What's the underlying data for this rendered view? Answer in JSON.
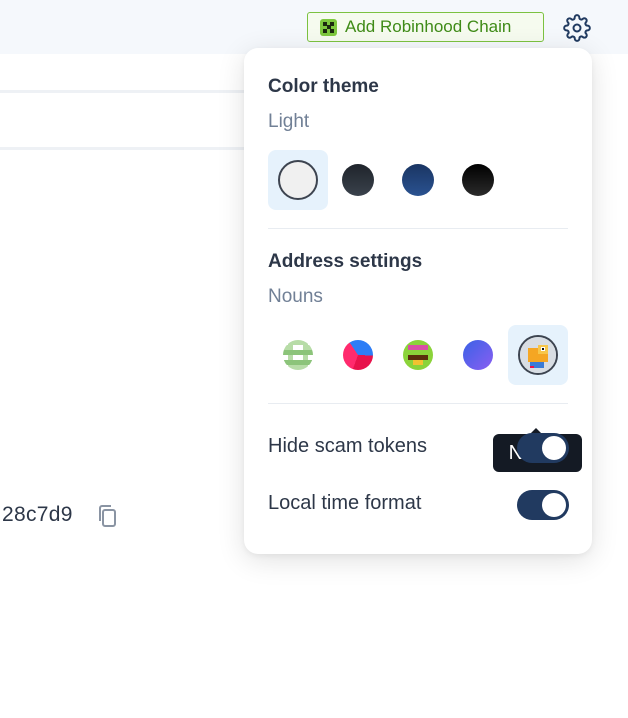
{
  "header": {
    "add_chain_label": "Add Robinhood Chain",
    "settings_icon": "gear-icon"
  },
  "background": {
    "hash_fragment": "28c7d9",
    "copy_icon": "copy-icon"
  },
  "settings": {
    "color_theme": {
      "title": "Color theme",
      "selected_label": "Light",
      "options": [
        {
          "name": "light",
          "color": "#f0f0f0",
          "selected": true
        },
        {
          "name": "dim",
          "color": "#2b3139",
          "selected": false
        },
        {
          "name": "midnight",
          "color": "#1f3f73",
          "selected": false
        },
        {
          "name": "dark",
          "color": "#111111",
          "selected": false
        }
      ]
    },
    "address": {
      "title": "Address settings",
      "selected_label": "Nouns",
      "options": [
        {
          "name": "identicon",
          "selected": false
        },
        {
          "name": "gradient-avatar",
          "selected": false
        },
        {
          "name": "pixel-face",
          "selected": false
        },
        {
          "name": "blockie",
          "selected": false
        },
        {
          "name": "nouns",
          "selected": true
        }
      ],
      "tooltip": "Nouns"
    },
    "toggles": [
      {
        "label": "Hide scam tokens",
        "on": true
      },
      {
        "label": "Local time format",
        "on": true
      }
    ]
  },
  "colors": {
    "accent": "#213a60",
    "chain_green": "#3f8b17",
    "selected_bg": "#e6f2fc"
  }
}
